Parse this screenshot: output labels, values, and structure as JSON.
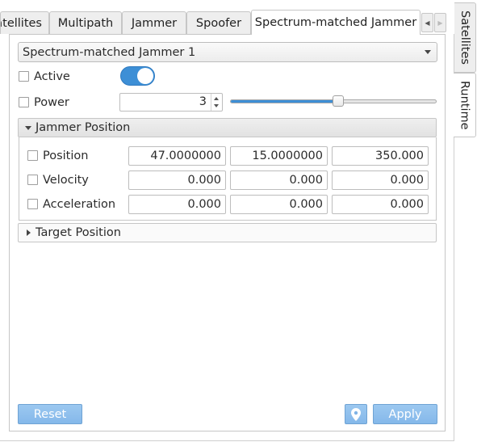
{
  "tabs": [
    {
      "label": "Satellites"
    },
    {
      "label": "Multipath"
    },
    {
      "label": "Jammer"
    },
    {
      "label": "Spoofer"
    },
    {
      "label": "Spectrum-matched Jammer"
    }
  ],
  "side_tabs": [
    {
      "label": "Satellites"
    },
    {
      "label": "Runtime"
    }
  ],
  "jammer_select": {
    "value": "Spectrum-matched Jammer 1"
  },
  "active": {
    "label": "Active",
    "checked": false,
    "switch_on": true
  },
  "power": {
    "label": "Power",
    "checked": false,
    "value": "3",
    "slider_fraction": 0.52
  },
  "jammer_position": {
    "title": "Jammer Position",
    "expanded": true,
    "rows": [
      {
        "label": "Position",
        "checked": false,
        "values": [
          "47.0000000",
          "15.0000000",
          "350.000"
        ]
      },
      {
        "label": "Velocity",
        "checked": false,
        "values": [
          "0.000",
          "0.000",
          "0.000"
        ]
      },
      {
        "label": "Acceleration",
        "checked": false,
        "values": [
          "0.000",
          "0.000",
          "0.000"
        ]
      }
    ]
  },
  "target_position": {
    "title": "Target Position",
    "expanded": false
  },
  "buttons": {
    "reset": "Reset",
    "apply": "Apply",
    "location_icon": "map-pin-icon"
  },
  "colors": {
    "accent": "#3d8fd6",
    "button": "#8fbfee"
  }
}
